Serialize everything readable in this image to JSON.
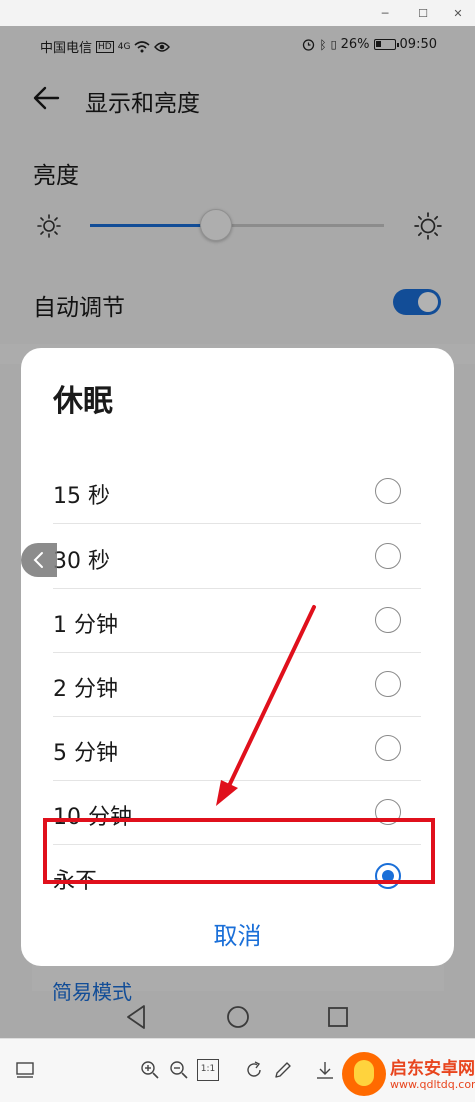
{
  "status_bar": {
    "carrier": "中国电信",
    "network_badge": "HD",
    "signal": "4G",
    "battery_percent": "26%",
    "time": "09:50"
  },
  "header": {
    "title": "显示和亮度"
  },
  "brightness": {
    "label": "亮度",
    "level_fraction": 0.43
  },
  "auto_adjust": {
    "label": "自动调节",
    "enabled": true
  },
  "dialog": {
    "title": "休眠",
    "options": [
      {
        "label": "15 秒",
        "selected": false
      },
      {
        "label": "30 秒",
        "selected": false
      },
      {
        "label": "1 分钟",
        "selected": false
      },
      {
        "label": "2 分钟",
        "selected": false
      },
      {
        "label": "5 分钟",
        "selected": false
      },
      {
        "label": "10 分钟",
        "selected": false
      },
      {
        "label": "永不",
        "selected": true
      }
    ],
    "cancel_label": "取消"
  },
  "background": {
    "partial_link": "简易模式"
  },
  "toolbar": {
    "actual_size_label": "1:1"
  },
  "watermark": {
    "name": "启东安卓网",
    "url": "www.qdltdq.com"
  },
  "colors": {
    "accent": "#1a6fd8",
    "annotation": "#e0101c"
  }
}
